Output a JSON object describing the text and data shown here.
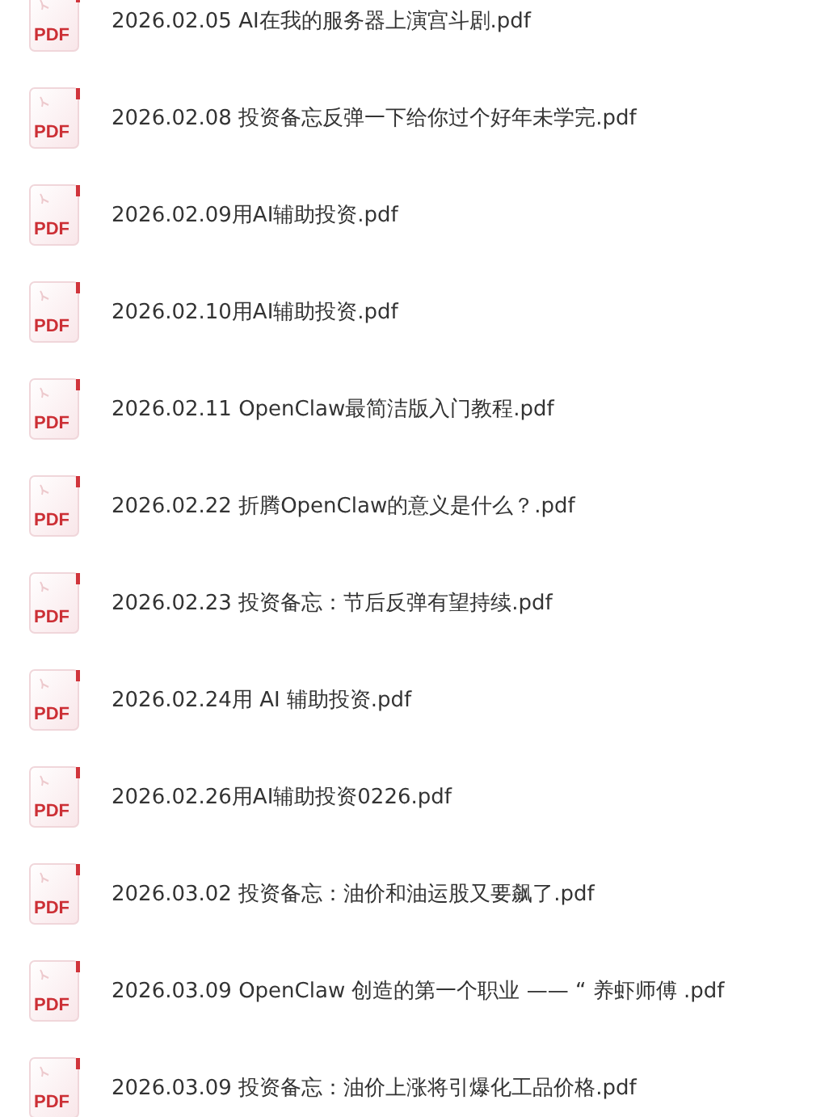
{
  "files": [
    {
      "name": "2026.02.05 AI在我的服务器上演宫斗剧.pdf",
      "type_label": "PDF"
    },
    {
      "name": "2026.02.08 投资备忘反弹一下给你过个好年未学完.pdf",
      "type_label": "PDF"
    },
    {
      "name": "2026.02.09用AI辅助投资.pdf",
      "type_label": "PDF"
    },
    {
      "name": "2026.02.10用AI辅助投资.pdf",
      "type_label": "PDF"
    },
    {
      "name": "2026.02.11 OpenClaw最简洁版入门教程.pdf",
      "type_label": "PDF"
    },
    {
      "name": "2026.02.22 折腾OpenClaw的意义是什么？.pdf",
      "type_label": "PDF"
    },
    {
      "name": "2026.02.23 投资备忘：节后反弹有望持续.pdf",
      "type_label": "PDF"
    },
    {
      "name": "2026.02.24用 AI 辅助投资.pdf",
      "type_label": "PDF"
    },
    {
      "name": "2026.02.26用AI辅助投资0226.pdf",
      "type_label": "PDF"
    },
    {
      "name": "2026.03.02 投资备忘：油价和油运股又要飙了.pdf",
      "type_label": "PDF"
    },
    {
      "name": "2026.03.09 OpenClaw 创造的第一个职业 —— “ 养虾师傅 .pdf",
      "type_label": "PDF"
    },
    {
      "name": "2026.03.09 投资备忘：油价上涨将引爆化工品价格.pdf",
      "type_label": "PDF"
    }
  ]
}
